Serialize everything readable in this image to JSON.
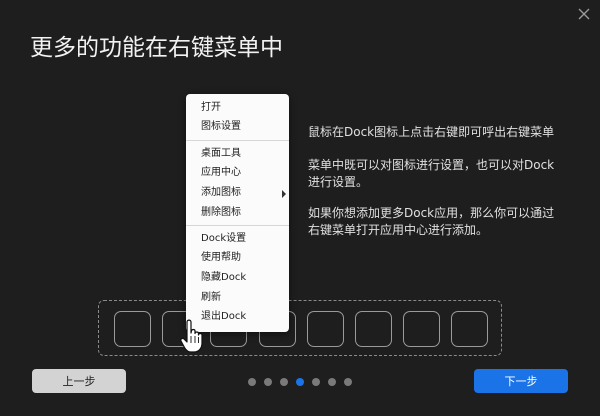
{
  "window": {
    "title": "更多的功能在右键菜单中"
  },
  "context_menu": {
    "items": [
      "打开",
      "图标设置",
      "桌面工具",
      "应用中心",
      "添加图标",
      "删除图标",
      "Dock设置",
      "使用帮助",
      "隐藏Dock",
      "刷新",
      "退出Dock"
    ]
  },
  "description": {
    "line1": "鼠标在Dock图标上点击右键即可呼出右键菜单",
    "line2a": "菜单中既可以对图标进行设置，也可以对Dock",
    "line2b": "进行设置。",
    "line3a": "如果你想添加更多Dock应用，那么你可以通过",
    "line3b": "右键菜单打开应用中心进行添加。"
  },
  "buttons": {
    "prev": "上一步",
    "next": "下一步"
  },
  "pager": {
    "total": 7,
    "active": 3
  },
  "colors": {
    "accent": "#1b73e8",
    "background": "#1e1e1e",
    "menu_bg": "#fbfbfb"
  }
}
